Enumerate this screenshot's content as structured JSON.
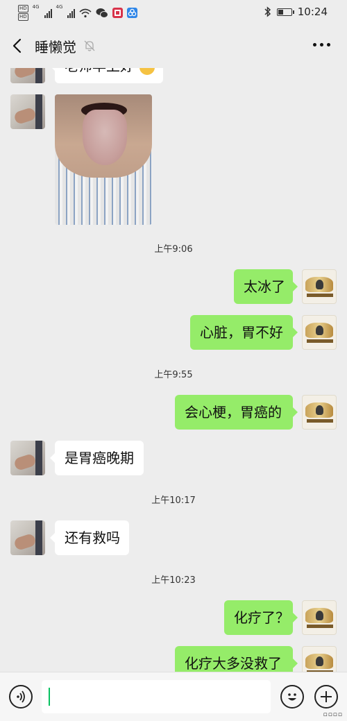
{
  "status_bar": {
    "time": "10:24",
    "hd_labels": [
      "HD",
      "HD"
    ],
    "network_labels": [
      "4G",
      "4G"
    ],
    "battery_level": 0.35,
    "icons": [
      "signal-icon",
      "wifi-icon",
      "wechat-icon",
      "book-app-icon",
      "eye-app-icon",
      "bluetooth-icon",
      "battery-icon"
    ]
  },
  "header": {
    "title": "睡懒觉",
    "icons": [
      "back-icon",
      "mute-bell-icon",
      "more-icon"
    ]
  },
  "messages": [
    {
      "type": "text",
      "from": "friend",
      "text": "老师早上好",
      "partial": true
    },
    {
      "type": "image",
      "from": "friend",
      "image_desc": "tongue-photo"
    },
    {
      "type": "timestamp",
      "text": "上午9:06"
    },
    {
      "type": "text",
      "from": "me",
      "text": "太冰了"
    },
    {
      "type": "text",
      "from": "me",
      "text": "心脏，胃不好"
    },
    {
      "type": "timestamp",
      "text": "上午9:55"
    },
    {
      "type": "text",
      "from": "me",
      "text": "会心梗，胃癌的"
    },
    {
      "type": "text",
      "from": "friend",
      "text": "是胃癌晚期"
    },
    {
      "type": "timestamp",
      "text": "上午10:17"
    },
    {
      "type": "text",
      "from": "friend",
      "text": "还有救吗"
    },
    {
      "type": "timestamp",
      "text": "上午10:23"
    },
    {
      "type": "text",
      "from": "me",
      "text": "化疗了？"
    },
    {
      "type": "text",
      "from": "me",
      "text": "化疗大多没救了"
    }
  ],
  "input_bar": {
    "value": "",
    "icons": [
      "voice-icon",
      "emoji-icon",
      "plus-icon"
    ]
  },
  "colors": {
    "background": "#ededed",
    "bubble_me": "#95ec69",
    "bubble_friend": "#ffffff",
    "caret": "#07c160"
  }
}
